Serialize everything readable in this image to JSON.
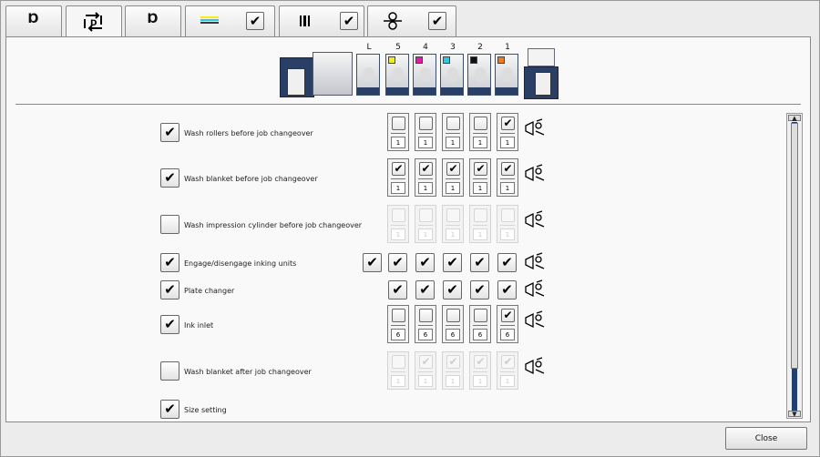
{
  "tabs": [
    {
      "icon": "ink-unit-icon",
      "glyph": "ᴅ",
      "checkbox": false
    },
    {
      "icon": "changeover-icon",
      "glyph": "⇅",
      "checkbox": false,
      "active": true
    },
    {
      "icon": "ink-unit-icon",
      "glyph": "ᴅ",
      "checkbox": false
    },
    {
      "icon": "ink-lines-icon",
      "glyph": "≡",
      "checkbox": true,
      "checked": true
    },
    {
      "icon": "plate-icon",
      "glyph": "‖",
      "checkbox": true,
      "checked": true
    },
    {
      "icon": "roller-icon",
      "glyph": "⊕",
      "checkbox": true,
      "checked": true
    }
  ],
  "press": {
    "units": [
      {
        "label": "L",
        "color": ""
      },
      {
        "label": "5",
        "color": "#f2ee1a"
      },
      {
        "label": "4",
        "color": "#e21aa8"
      },
      {
        "label": "3",
        "color": "#2ec7e6"
      },
      {
        "label": "2",
        "color": "#111111"
      },
      {
        "label": "1",
        "color": "#f07a1e"
      }
    ]
  },
  "rows": [
    {
      "label": "Wash rollers before job changeover",
      "checked": true,
      "enabled": true,
      "cells": [
        false,
        false,
        false,
        false,
        true
      ],
      "value": "1",
      "icon": "wash-rollers-icon"
    },
    {
      "label": "Wash blanket before job changeover",
      "checked": true,
      "enabled": true,
      "cells": [
        true,
        true,
        true,
        true,
        true
      ],
      "value": "1",
      "icon": "wash-blanket-icon"
    },
    {
      "label": "Wash impression cylinder before job changeover",
      "checked": false,
      "enabled": false,
      "cells": [
        false,
        false,
        false,
        false,
        false
      ],
      "value": "1",
      "icon": "wash-impression-icon"
    },
    {
      "label": "Engage/disengage inking units",
      "checked": true,
      "inline_cells": [
        true,
        true,
        true,
        true,
        true,
        true
      ],
      "icon": "inking-unit-icon"
    },
    {
      "label": "Plate changer",
      "checked": true,
      "inline_cells": [
        true,
        true,
        true,
        true,
        true
      ],
      "icon": "plate-changer-icon"
    },
    {
      "label": "Ink inlet",
      "checked": true,
      "enabled": true,
      "cells": [
        false,
        false,
        false,
        false,
        true
      ],
      "value": "6",
      "icon": "ink-inlet-icon"
    },
    {
      "label": "Wash blanket after job changeover",
      "checked": false,
      "enabled": false,
      "cells": [
        false,
        true,
        true,
        true,
        true
      ],
      "value": "1",
      "icon": "wash-blanket-after-icon"
    },
    {
      "label": "Size setting",
      "checked": true
    }
  ],
  "close_label": "Close",
  "check_glyph": "✔"
}
